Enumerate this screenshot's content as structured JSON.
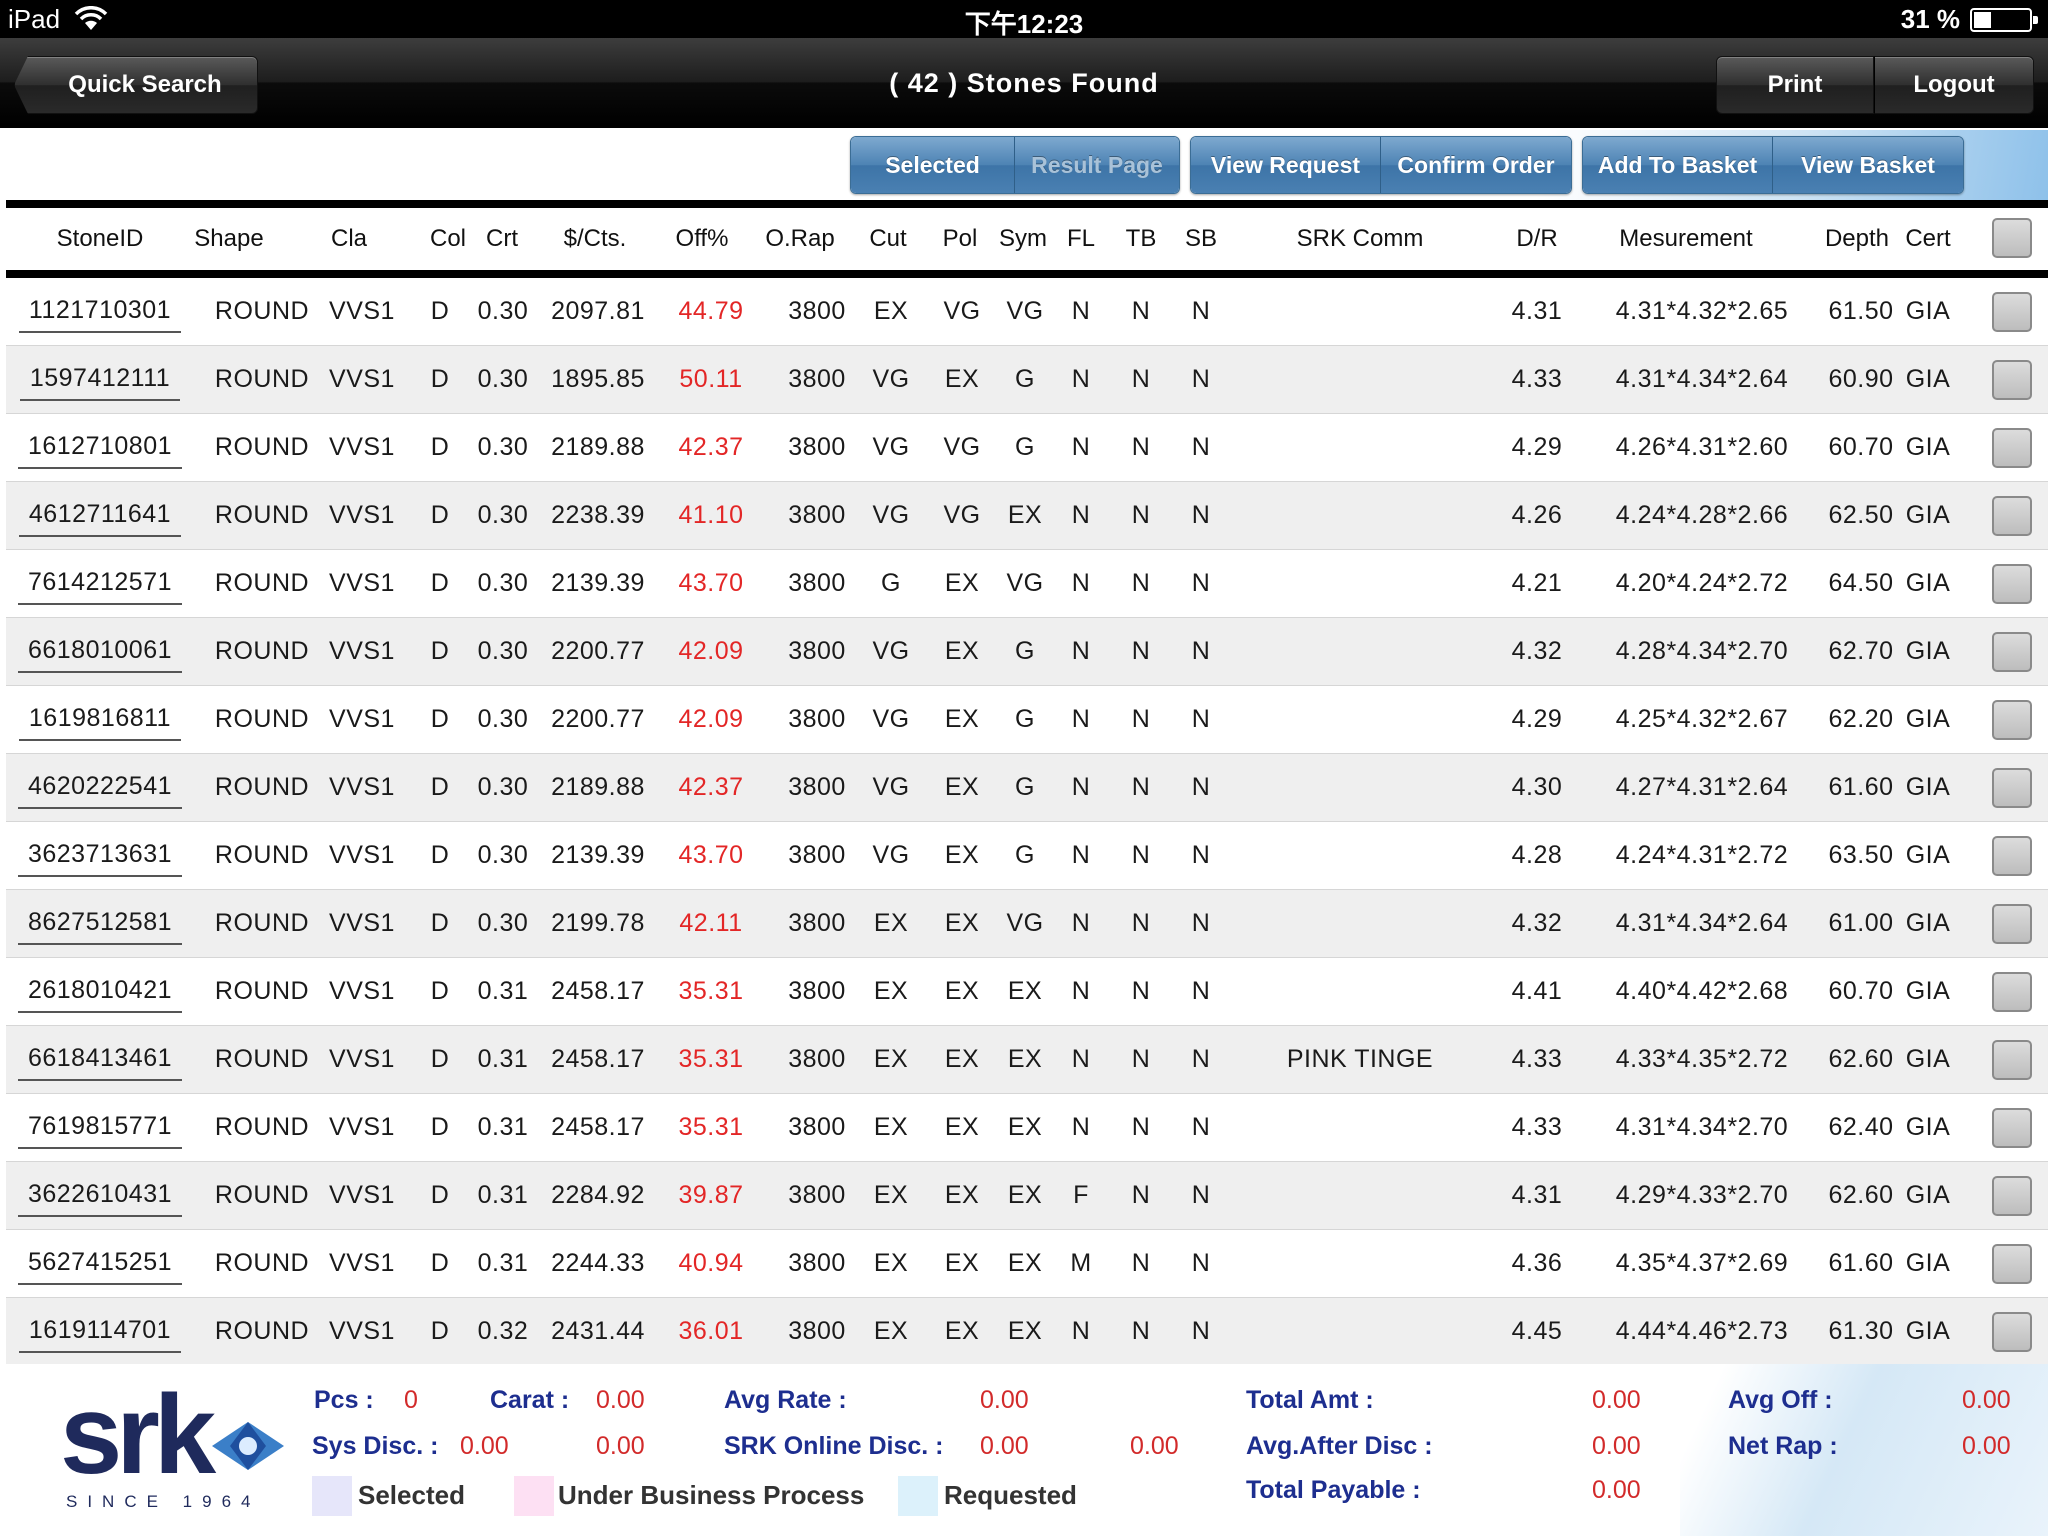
{
  "status_bar": {
    "device": "iPad",
    "time": "下午12:23",
    "battery": "31 %",
    "battery_level": 0.31
  },
  "nav": {
    "back_label": "Quick Search",
    "title": "( 42 ) Stones Found",
    "print_label": "Print",
    "logout_label": "Logout"
  },
  "toolbar": {
    "selected": "Selected",
    "result_page": "Result Page",
    "view_request": "View Request",
    "confirm_order": "Confirm Order",
    "add_to_basket": "Add To Basket",
    "view_basket": "View Basket"
  },
  "table": {
    "headers": {
      "stone_id": "StoneID",
      "shape": "Shape",
      "cla": "Cla",
      "col": "Col",
      "crt": "Crt",
      "price": "$/Cts.",
      "off": "Off%",
      "orap": "O.Rap",
      "cut": "Cut",
      "pol": "Pol",
      "sym": "Sym",
      "fl": "FL",
      "tb": "TB",
      "sb": "SB",
      "comment": "SRK Comm",
      "dr": "D/R",
      "measurement": "Mesurement",
      "depth": "Depth",
      "cert": "Cert"
    },
    "rows": [
      {
        "id": "1121710301",
        "shape": "ROUND",
        "cla": "VVS1",
        "col": "D",
        "crt": "0.30",
        "price": "2097.81",
        "off": "44.79",
        "orap": "3800",
        "cut": "EX",
        "pol": "VG",
        "sym": "VG",
        "fl": "N",
        "tb": "N",
        "sb": "N",
        "comment": "",
        "dr": "4.31",
        "meas": "4.31*4.32*2.65",
        "depth": "61.50",
        "cert": "GIA"
      },
      {
        "id": "1597412111",
        "shape": "ROUND",
        "cla": "VVS1",
        "col": "D",
        "crt": "0.30",
        "price": "1895.85",
        "off": "50.11",
        "orap": "3800",
        "cut": "VG",
        "pol": "EX",
        "sym": "G",
        "fl": "N",
        "tb": "N",
        "sb": "N",
        "comment": "",
        "dr": "4.33",
        "meas": "4.31*4.34*2.64",
        "depth": "60.90",
        "cert": "GIA"
      },
      {
        "id": "1612710801",
        "shape": "ROUND",
        "cla": "VVS1",
        "col": "D",
        "crt": "0.30",
        "price": "2189.88",
        "off": "42.37",
        "orap": "3800",
        "cut": "VG",
        "pol": "VG",
        "sym": "G",
        "fl": "N",
        "tb": "N",
        "sb": "N",
        "comment": "",
        "dr": "4.29",
        "meas": "4.26*4.31*2.60",
        "depth": "60.70",
        "cert": "GIA"
      },
      {
        "id": "4612711641",
        "shape": "ROUND",
        "cla": "VVS1",
        "col": "D",
        "crt": "0.30",
        "price": "2238.39",
        "off": "41.10",
        "orap": "3800",
        "cut": "VG",
        "pol": "VG",
        "sym": "EX",
        "fl": "N",
        "tb": "N",
        "sb": "N",
        "comment": "",
        "dr": "4.26",
        "meas": "4.24*4.28*2.66",
        "depth": "62.50",
        "cert": "GIA"
      },
      {
        "id": "7614212571",
        "shape": "ROUND",
        "cla": "VVS1",
        "col": "D",
        "crt": "0.30",
        "price": "2139.39",
        "off": "43.70",
        "orap": "3800",
        "cut": "G",
        "pol": "EX",
        "sym": "VG",
        "fl": "N",
        "tb": "N",
        "sb": "N",
        "comment": "",
        "dr": "4.21",
        "meas": "4.20*4.24*2.72",
        "depth": "64.50",
        "cert": "GIA"
      },
      {
        "id": "6618010061",
        "shape": "ROUND",
        "cla": "VVS1",
        "col": "D",
        "crt": "0.30",
        "price": "2200.77",
        "off": "42.09",
        "orap": "3800",
        "cut": "VG",
        "pol": "EX",
        "sym": "G",
        "fl": "N",
        "tb": "N",
        "sb": "N",
        "comment": "",
        "dr": "4.32",
        "meas": "4.28*4.34*2.70",
        "depth": "62.70",
        "cert": "GIA"
      },
      {
        "id": "1619816811",
        "shape": "ROUND",
        "cla": "VVS1",
        "col": "D",
        "crt": "0.30",
        "price": "2200.77",
        "off": "42.09",
        "orap": "3800",
        "cut": "VG",
        "pol": "EX",
        "sym": "G",
        "fl": "N",
        "tb": "N",
        "sb": "N",
        "comment": "",
        "dr": "4.29",
        "meas": "4.25*4.32*2.67",
        "depth": "62.20",
        "cert": "GIA"
      },
      {
        "id": "4620222541",
        "shape": "ROUND",
        "cla": "VVS1",
        "col": "D",
        "crt": "0.30",
        "price": "2189.88",
        "off": "42.37",
        "orap": "3800",
        "cut": "VG",
        "pol": "EX",
        "sym": "G",
        "fl": "N",
        "tb": "N",
        "sb": "N",
        "comment": "",
        "dr": "4.30",
        "meas": "4.27*4.31*2.64",
        "depth": "61.60",
        "cert": "GIA"
      },
      {
        "id": "3623713631",
        "shape": "ROUND",
        "cla": "VVS1",
        "col": "D",
        "crt": "0.30",
        "price": "2139.39",
        "off": "43.70",
        "orap": "3800",
        "cut": "VG",
        "pol": "EX",
        "sym": "G",
        "fl": "N",
        "tb": "N",
        "sb": "N",
        "comment": "",
        "dr": "4.28",
        "meas": "4.24*4.31*2.72",
        "depth": "63.50",
        "cert": "GIA"
      },
      {
        "id": "8627512581",
        "shape": "ROUND",
        "cla": "VVS1",
        "col": "D",
        "crt": "0.30",
        "price": "2199.78",
        "off": "42.11",
        "orap": "3800",
        "cut": "EX",
        "pol": "EX",
        "sym": "VG",
        "fl": "N",
        "tb": "N",
        "sb": "N",
        "comment": "",
        "dr": "4.32",
        "meas": "4.31*4.34*2.64",
        "depth": "61.00",
        "cert": "GIA"
      },
      {
        "id": "2618010421",
        "shape": "ROUND",
        "cla": "VVS1",
        "col": "D",
        "crt": "0.31",
        "price": "2458.17",
        "off": "35.31",
        "orap": "3800",
        "cut": "EX",
        "pol": "EX",
        "sym": "EX",
        "fl": "N",
        "tb": "N",
        "sb": "N",
        "comment": "",
        "dr": "4.41",
        "meas": "4.40*4.42*2.68",
        "depth": "60.70",
        "cert": "GIA"
      },
      {
        "id": "6618413461",
        "shape": "ROUND",
        "cla": "VVS1",
        "col": "D",
        "crt": "0.31",
        "price": "2458.17",
        "off": "35.31",
        "orap": "3800",
        "cut": "EX",
        "pol": "EX",
        "sym": "EX",
        "fl": "N",
        "tb": "N",
        "sb": "N",
        "comment": "PINK TINGE",
        "dr": "4.33",
        "meas": "4.33*4.35*2.72",
        "depth": "62.60",
        "cert": "GIA"
      },
      {
        "id": "7619815771",
        "shape": "ROUND",
        "cla": "VVS1",
        "col": "D",
        "crt": "0.31",
        "price": "2458.17",
        "off": "35.31",
        "orap": "3800",
        "cut": "EX",
        "pol": "EX",
        "sym": "EX",
        "fl": "N",
        "tb": "N",
        "sb": "N",
        "comment": "",
        "dr": "4.33",
        "meas": "4.31*4.34*2.70",
        "depth": "62.40",
        "cert": "GIA"
      },
      {
        "id": "3622610431",
        "shape": "ROUND",
        "cla": "VVS1",
        "col": "D",
        "crt": "0.31",
        "price": "2284.92",
        "off": "39.87",
        "orap": "3800",
        "cut": "EX",
        "pol": "EX",
        "sym": "EX",
        "fl": "F",
        "tb": "N",
        "sb": "N",
        "comment": "",
        "dr": "4.31",
        "meas": "4.29*4.33*2.70",
        "depth": "62.60",
        "cert": "GIA"
      },
      {
        "id": "5627415251",
        "shape": "ROUND",
        "cla": "VVS1",
        "col": "D",
        "crt": "0.31",
        "price": "2244.33",
        "off": "40.94",
        "orap": "3800",
        "cut": "EX",
        "pol": "EX",
        "sym": "EX",
        "fl": "M",
        "tb": "N",
        "sb": "N",
        "comment": "",
        "dr": "4.36",
        "meas": "4.35*4.37*2.69",
        "depth": "61.60",
        "cert": "GIA"
      },
      {
        "id": "1619114701",
        "shape": "ROUND",
        "cla": "VVS1",
        "col": "D",
        "crt": "0.32",
        "price": "2431.44",
        "off": "36.01",
        "orap": "3800",
        "cut": "EX",
        "pol": "EX",
        "sym": "EX",
        "fl": "N",
        "tb": "N",
        "sb": "N",
        "comment": "",
        "dr": "4.45",
        "meas": "4.44*4.46*2.73",
        "depth": "61.30",
        "cert": "GIA"
      }
    ]
  },
  "footer": {
    "logo_text": "srk",
    "logo_since": "SINCE 1964",
    "pcs_label": "Pcs :",
    "pcs_value": "0",
    "carat_label": "Carat :",
    "carat_value": "0.00",
    "avg_rate_label": "Avg Rate :",
    "avg_rate_value": "0.00",
    "total_amt_label": "Total Amt :",
    "total_amt_value": "0.00",
    "avg_off_label": "Avg Off  :",
    "avg_off_value": "0.00",
    "sys_disc_label": "Sys Disc. :",
    "sys_disc_value": "0.00",
    "sys_disc_value2": "0.00",
    "srk_online_label": "SRK Online Disc. :",
    "srk_online_value": "0.00",
    "srk_online_value2": "0.00",
    "avg_after_label": "Avg.After Disc :",
    "avg_after_value": "0.00",
    "net_rap_label": "Net Rap  :",
    "net_rap_value": "0.00",
    "total_payable_label": "Total Payable :",
    "total_payable_value": "0.00",
    "legend": [
      {
        "label": "Selected",
        "color": "#e6e6fa"
      },
      {
        "label": "Under Business Process",
        "color": "#fde0f3"
      },
      {
        "label": "Requested",
        "color": "#dcf1fb"
      }
    ]
  },
  "colors": {
    "discount_red": "#e32626",
    "label_blue": "#1d2e8f",
    "value_red": "#d22a2a",
    "button_blue": "#4a80b2"
  }
}
